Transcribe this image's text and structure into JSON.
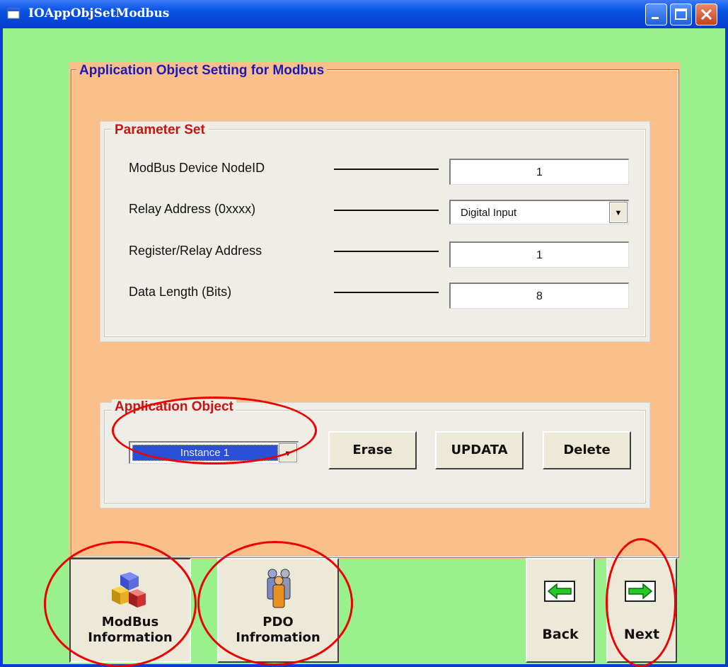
{
  "window": {
    "title": "IOAppObjSetModbus"
  },
  "main_group": {
    "legend": "Application Object Setting for Modbus"
  },
  "parameter_set": {
    "legend": "Parameter Set",
    "fields": [
      {
        "label": "ModBus Device NodeID",
        "value": "1"
      },
      {
        "label": "Relay Address (0xxxx)",
        "value": "Digital Input"
      },
      {
        "label": "Register/Relay Address",
        "value": "1"
      },
      {
        "label": "Data Length (Bits)",
        "value": "8"
      }
    ]
  },
  "application_object": {
    "legend": "Application Object",
    "instance_selected": "Instance 1",
    "erase_label": "Erase",
    "updata_label": "UPDATA",
    "delete_label": "Delete"
  },
  "nav": {
    "modbus_info_line1": "ModBus",
    "modbus_info_line2": "Information",
    "pdo_info_line1": "PDO",
    "pdo_info_line2": "Infromation",
    "back_label": "Back",
    "next_label": "Next"
  },
  "colors": {
    "client_bg": "#9bf08e",
    "orange_group": "#fbbf8b",
    "legend_blue": "#1a1ab4",
    "legend_red": "#d01010",
    "highlight": "#e00000"
  }
}
